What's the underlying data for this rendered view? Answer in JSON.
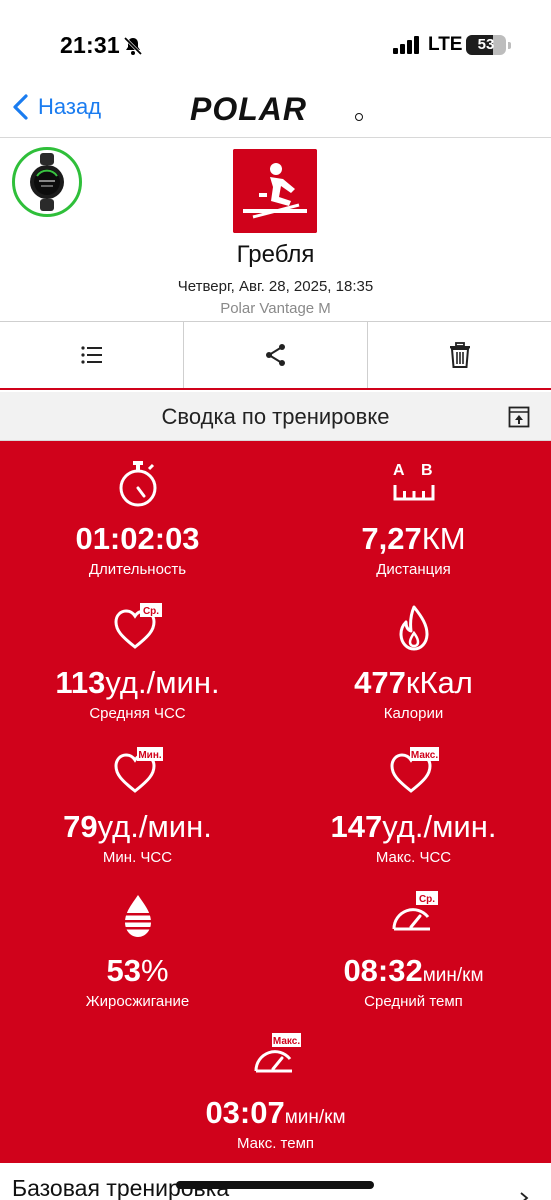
{
  "status_bar": {
    "time": "21:31",
    "network": "LTE",
    "battery": "53"
  },
  "nav": {
    "back_label": "Назад",
    "logo": "POLAR"
  },
  "header": {
    "sport": "Гребля",
    "datetime": "Четверг, Авг. 28, 2025, 18:35",
    "device": "Polar Vantage M"
  },
  "summary": {
    "title": "Сводка по тренировке"
  },
  "stats": [
    {
      "value": "01:02:03",
      "unit": "",
      "label": "Длительность",
      "icon": "stopwatch-icon"
    },
    {
      "value": "7,27",
      "unit": "КМ",
      "label": "Дистанция",
      "icon": "distance-ab-icon",
      "badge_a": "A",
      "badge_b": "B"
    },
    {
      "value": "113",
      "unit": "уд./мин.",
      "label": "Средняя ЧСС",
      "icon": "heart-avg-icon",
      "badge": "Ср."
    },
    {
      "value": "477",
      "unit": "кКал",
      "label": "Калории",
      "icon": "flame-icon"
    },
    {
      "value": "79",
      "unit": "уд./мин.",
      "label": "Мин. ЧСС",
      "icon": "heart-min-icon",
      "badge": "Мин."
    },
    {
      "value": "147",
      "unit": "уд./мин.",
      "label": "Макс. ЧСС",
      "icon": "heart-max-icon",
      "badge": "Макс."
    },
    {
      "value": "53",
      "unit": "%",
      "label": "Жиросжигание",
      "icon": "fat-burn-icon"
    },
    {
      "value": "08:32",
      "unit": "мин/км",
      "label": "Средний темп",
      "icon": "pace-avg-icon",
      "badge": "Ср."
    },
    {
      "value": "03:07",
      "unit": "мин/км",
      "label": "Макс. темп",
      "icon": "pace-max-icon",
      "badge": "Макс."
    }
  ],
  "bottom": {
    "title": "Базовая тренировка"
  },
  "colors": {
    "brand_red": "#d0021b",
    "link_blue": "#1a7cf0",
    "watch_ring": "#2fbf3a"
  }
}
